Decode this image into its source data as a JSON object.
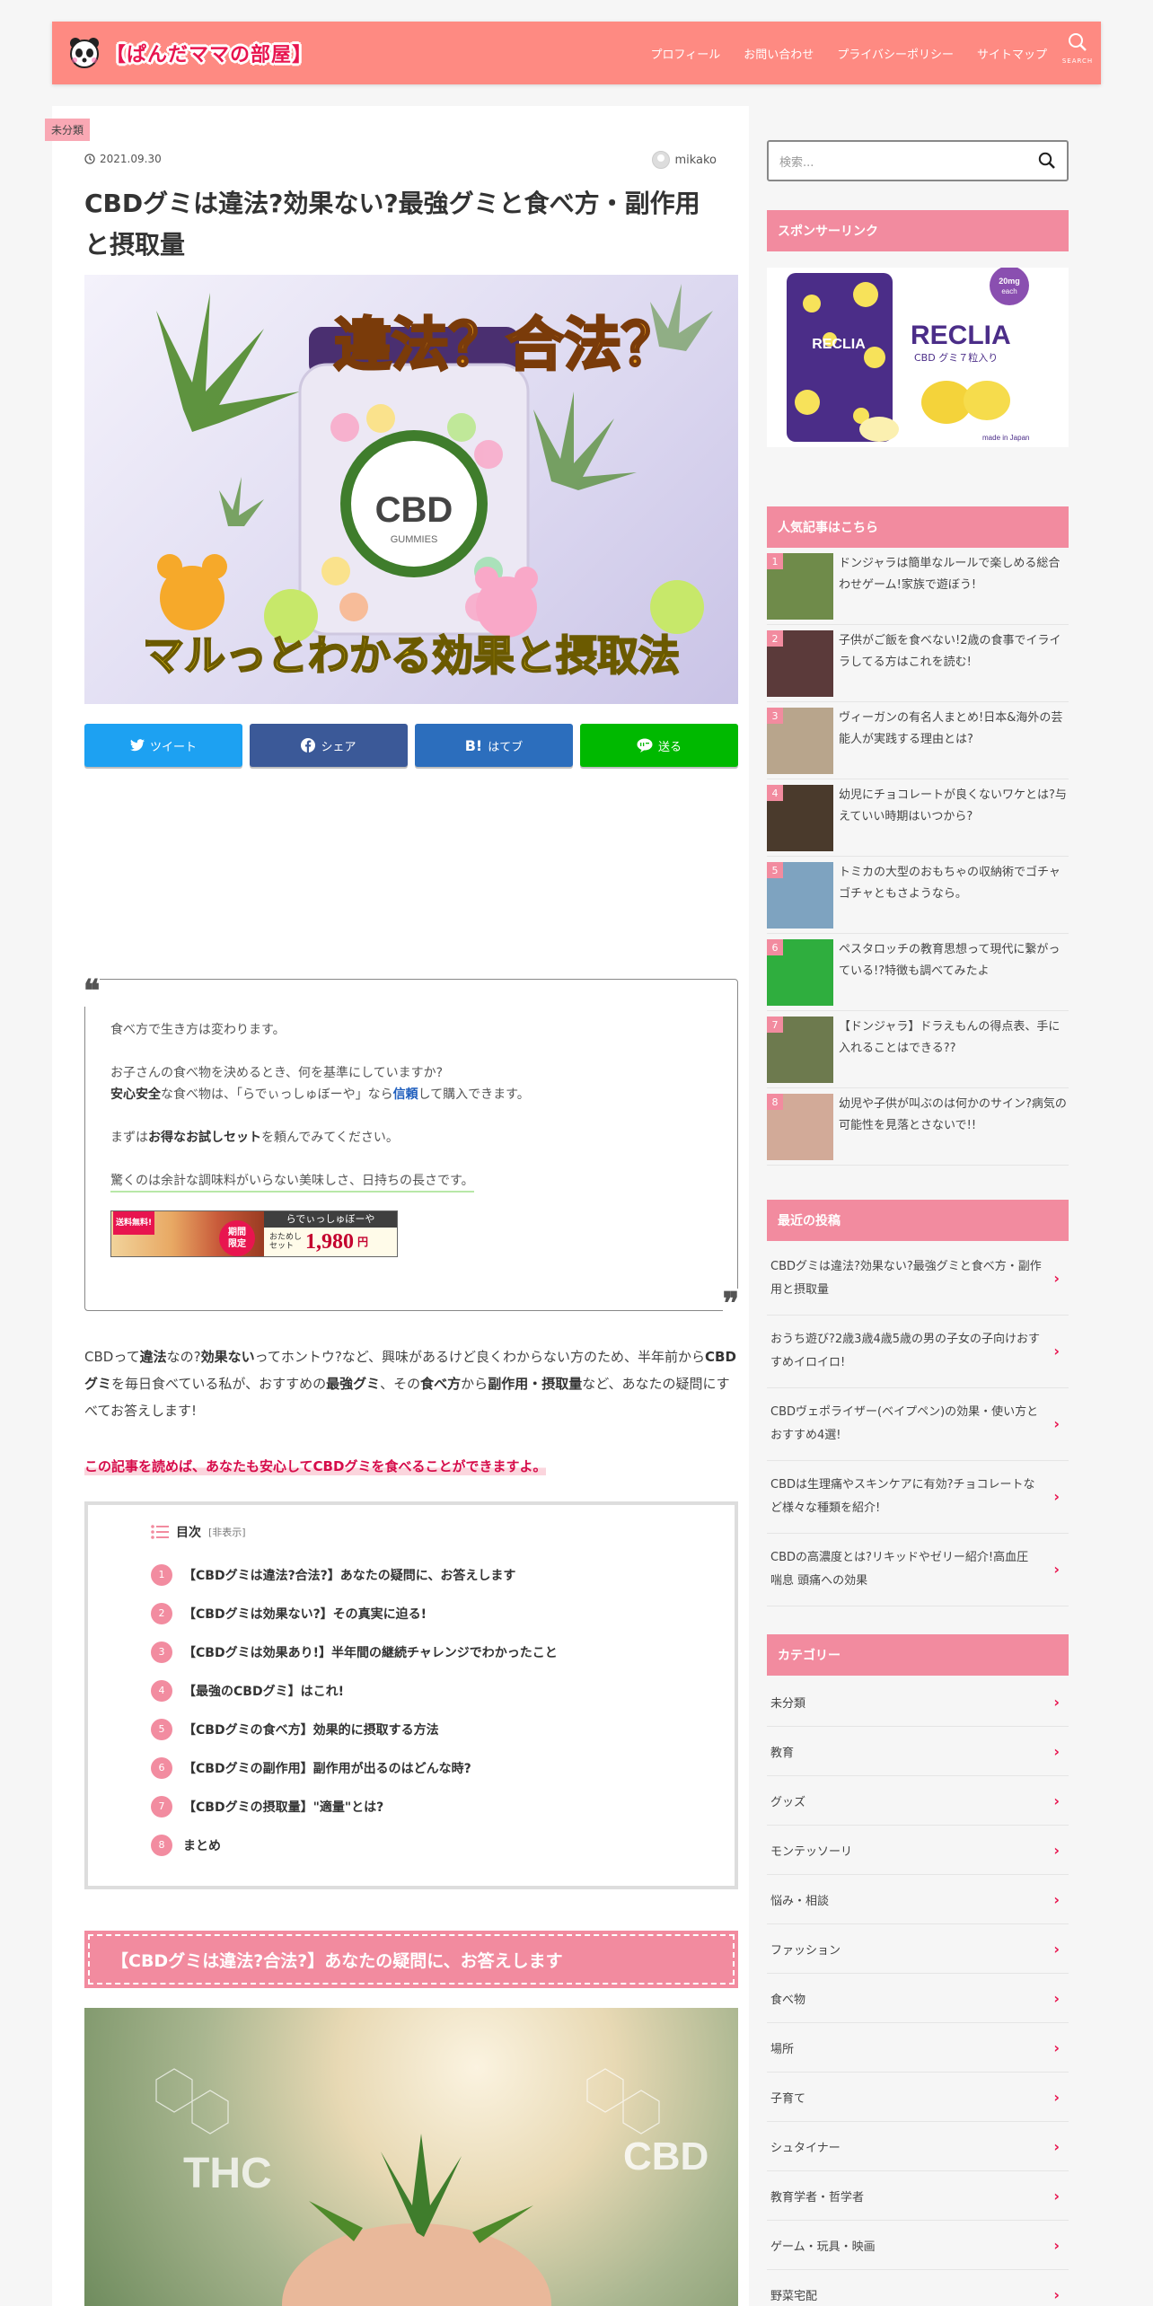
{
  "header": {
    "logo_text": "【ぱんだママの部屋】",
    "nav": [
      "プロフィール",
      "お問い合わせ",
      "プライバシーポリシー",
      "サイトマップ"
    ],
    "search_label": "SEARCH"
  },
  "article": {
    "category": "未分類",
    "date": "2021.09.30",
    "author": "mikako",
    "title": "CBDグミは違法?効果ない?最強グミと食べ方・副作用と摂取量",
    "eyecatch": {
      "headline": "違法？合法？",
      "jar_label": "CBD",
      "jar_sub": "GUMMIES",
      "bottom_line": "マルっとわかる効果と摂取法"
    },
    "share": [
      {
        "label": "ツイート",
        "icon": "twitter-icon",
        "color": "#1da1f2"
      },
      {
        "label": "シェア",
        "icon": "facebook-icon",
        "color": "#3b5998"
      },
      {
        "label": "はてブ",
        "icon": "hatena-icon",
        "color": "#2c6ebd"
      },
      {
        "label": "送る",
        "icon": "line-icon",
        "color": "#00b900"
      }
    ],
    "hatena_mark": "B!",
    "quote": {
      "line1": "食べ方で生き方は変わります。",
      "line2a": "お子さんの食べ物を決めるとき、何を基準にしていますか?",
      "line2b_bold": "安心安全",
      "line2b_mid": "な食べ物は、「らでぃっしゅぼーや」なら",
      "line2b_link": "信頼",
      "line2b_end": "して購入できます。",
      "line3a": "まずは",
      "line3_bold": "お得なお試しセット",
      "line3b": "を頼んでみてください。",
      "line4": "驚くのは余計な調味料がいらない美味しさ、日持ちの長さです。",
      "promo": {
        "badge_top": "送料無料!",
        "badge_a": "期間",
        "badge_b": "限定",
        "brand": "らでぃっしゅぼーや",
        "set_a": "おためし",
        "set_b": "セット",
        "price": "1,980",
        "yen": "円"
      }
    },
    "intro": {
      "t1": "CBDって",
      "b1": "違法",
      "t2": "なの?",
      "b2": "効果ない",
      "t3": "ってホントウ?など、興味があるけど良くわからない方のため、半年前から",
      "b3": "CBDグミ",
      "t4": "を毎日食べている私が、おすすめの",
      "b4": "最強グミ",
      "t5": "、その",
      "b5": "食べ方",
      "t6": "から",
      "b6": "副作用・摂取量",
      "t7": "など、あなたの疑問にすべてお答えします!"
    },
    "highlight": "この記事を読めば、あなたも安心してCBDグミを食べることができますよ。",
    "toc": {
      "title": "目次",
      "toggle": "[非表示]",
      "items": [
        {
          "num": "1",
          "label": "【CBDグミは違法?合法?】あなたの疑問に、お答えします"
        },
        {
          "num": "2",
          "label": "【CBDグミは効果ない?】その真実に迫る!"
        },
        {
          "num": "3",
          "label": "【CBDグミは効果あり!】半年間の継続チャレンジでわかったこと"
        },
        {
          "num": "4",
          "label": "【最強のCBDグミ】はこれ!"
        },
        {
          "num": "5",
          "label": "【CBDグミの食べ方】効果的に摂取する方法"
        },
        {
          "num": "6",
          "label": "【CBDグミの副作用】副作用が出るのはどんな時?"
        },
        {
          "num": "7",
          "label": "【CBDグミの摂取量】\"適量\"とは?"
        },
        {
          "num": "8",
          "label": "まとめ"
        }
      ]
    },
    "h2": "【CBDグミは違法?合法?】あなたの疑問に、お答えします",
    "h2_image": {
      "left": "THC",
      "right": "CBD"
    }
  },
  "sidebar": {
    "search_placeholder": "検索...",
    "sponsor": {
      "title": "スポンサーリンク",
      "brand": "RECLIA",
      "brand_sub": "CBD グミ７粒入り",
      "badge_a": "20mg",
      "badge_b": "each",
      "made": "made in Japan"
    },
    "popular": {
      "title": "人気記事はこちら",
      "items": [
        {
          "rank": "1",
          "text": "ドンジャラは簡単なルールで楽しめる総合わせゲーム!家族で遊ぼう!",
          "thumb": "#6f8b4a"
        },
        {
          "rank": "2",
          "text": "子供がご飯を食べない!2歳の食事でイライラしてる方はこれを読む!",
          "thumb": "#5b3a3a"
        },
        {
          "rank": "3",
          "text": "ヴィーガンの有名人まとめ!日本&海外の芸能人が実践する理由とは?",
          "thumb": "#b8a58c"
        },
        {
          "rank": "4",
          "text": "幼児にチョコレートが良くないワケとは?与えていい時期はいつから?",
          "thumb": "#4a3a2c"
        },
        {
          "rank": "5",
          "text": "トミカの大型のおもちゃの収納術でゴチャゴチャともさようなら。",
          "thumb": "#7ea3c0"
        },
        {
          "rank": "6",
          "text": "ペスタロッチの教育思想って現代に繋がっている!?特徴も調べてみたよ",
          "thumb": "#2fae3e"
        },
        {
          "rank": "7",
          "text": "【ドンジャラ】ドラえもんの得点表、手に入れることはできる??",
          "thumb": "#6d7a4e"
        },
        {
          "rank": "8",
          "text": "幼児や子供が叫ぶのは何かのサイン?病気の可能性を見落とさないで!!",
          "thumb": "#d2aa98"
        }
      ]
    },
    "recent": {
      "title": "最近の投稿",
      "items": [
        "CBDグミは違法?効果ない?最強グミと食べ方・副作用と摂取量",
        "おうち遊び?2歳3歳4歳5歳の男の子女の子向けおすすめイロイロ!",
        "CBDヴェポライザー(ベイプペン)の効果・使い方とおすすめ4選!",
        "CBDは生理痛やスキンケアに有効?チョコレートなど様々な種類を紹介!",
        "CBDの高濃度とは?リキッドやゼリー紹介!高血圧 喘息 頭痛への効果"
      ]
    },
    "categories": {
      "title": "カテゴリー",
      "items": [
        "未分類",
        "教育",
        "グッズ",
        "モンテッソーリ",
        "悩み・相談",
        "ファッション",
        "食べ物",
        "場所",
        "子育て",
        "シュタイナー",
        "教育学者・哲学者",
        "ゲーム・玩具・映画",
        "野菜宅配"
      ]
    }
  },
  "colors": {
    "header": "#fe8a82",
    "accent": "#f28b9f",
    "logo": "#e8154f"
  }
}
